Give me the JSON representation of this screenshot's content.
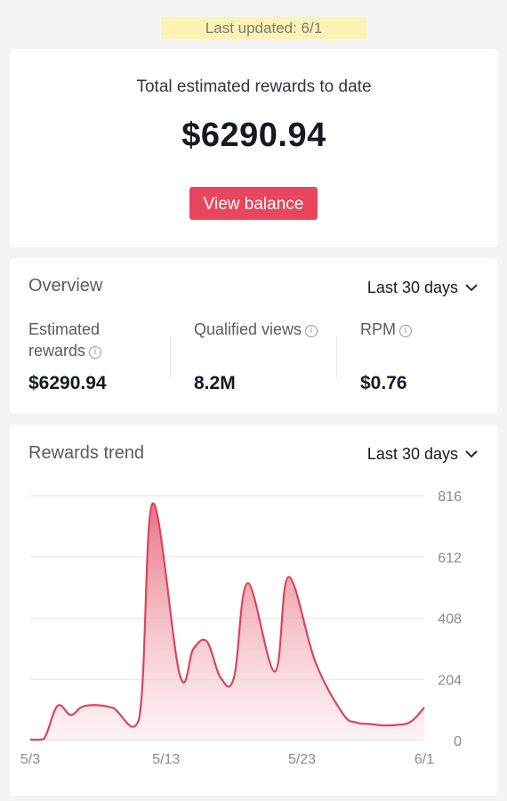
{
  "banner": {
    "text": "Last updated: 6/1"
  },
  "total": {
    "label": "Total estimated rewards to date",
    "amount": "$6290.94",
    "button_label": "View balance"
  },
  "overview": {
    "title": "Overview",
    "range": "Last 30 days",
    "metrics": [
      {
        "label": "Estimated rewards",
        "value": "$6290.94",
        "icon": "info-icon"
      },
      {
        "label": "Qualified views",
        "value": "8.2M",
        "icon": "info-icon"
      },
      {
        "label": "RPM",
        "value": "$0.76",
        "icon": "info-icon"
      }
    ]
  },
  "trend": {
    "title": "Rewards trend",
    "range": "Last 30 days"
  },
  "colors": {
    "accent": "#e8465c",
    "line": "#d9475c",
    "banner": "#fbf3b4"
  },
  "chart_data": {
    "type": "area",
    "title": "Rewards trend",
    "x_tick_labels": [
      "5/3",
      "5/13",
      "5/23",
      "6/1"
    ],
    "y_ticks": [
      0,
      204,
      408,
      612,
      816
    ],
    "ylim": [
      0,
      816
    ],
    "grid": true,
    "series": [
      {
        "values": [
          3,
          5,
          115,
          85,
          115,
          110,
          70,
          790,
          220,
          305,
          330,
          210,
          210,
          525,
          230,
          545,
          260,
          90,
          60,
          55,
          50,
          52,
          62,
          110
        ],
        "x_days": [
          "5/3",
          "5/4",
          "5/5",
          "5/6",
          "5/7",
          "5/9",
          "5/11",
          "5/12",
          "5/14",
          "5/15",
          "5/16",
          "5/17",
          "5/18",
          "5/19",
          "5/21",
          "5/22",
          "5/24",
          "5/26",
          "5/27",
          "5/28",
          "5/29",
          "5/30",
          "5/31",
          "6/1"
        ]
      }
    ]
  }
}
